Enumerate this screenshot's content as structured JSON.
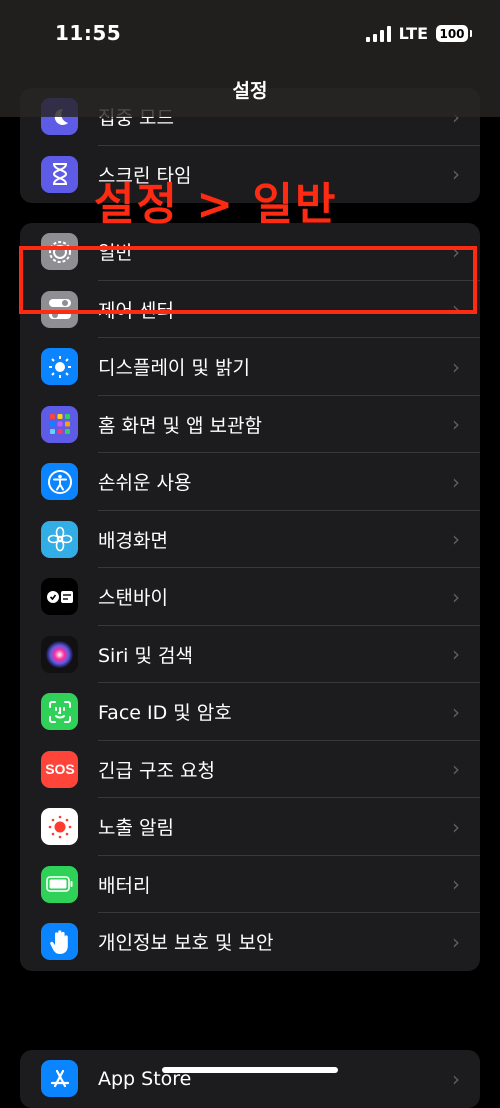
{
  "status": {
    "time": "11:55",
    "network": "LTE",
    "battery": "100"
  },
  "nav": {
    "title": "설정"
  },
  "annotation": {
    "text": "설정 > 일반"
  },
  "groups": {
    "top": [
      {
        "label": "집중 모드",
        "icon": "moon-icon",
        "color": "#5e5ce6"
      },
      {
        "label": "스크린 타임",
        "icon": "hourglass-icon",
        "color": "#5e5ce6"
      }
    ],
    "main": [
      {
        "label": "일반",
        "icon": "gear-icon",
        "color": "#8e8e93"
      },
      {
        "label": "제어 센터",
        "icon": "toggles-icon",
        "color": "#8e8e93"
      },
      {
        "label": "디스플레이 및 밝기",
        "icon": "sun-icon",
        "color": "#0a84ff"
      },
      {
        "label": "홈 화면 및 앱 보관함",
        "icon": "app-grid-icon",
        "color": "#5e5ce6"
      },
      {
        "label": "손쉬운 사용",
        "icon": "accessibility-icon",
        "color": "#0a84ff"
      },
      {
        "label": "배경화면",
        "icon": "flower-icon",
        "color": "#32ade6"
      },
      {
        "label": "스탠바이",
        "icon": "standby-icon",
        "color": "#000000"
      },
      {
        "label": "Siri 및 검색",
        "icon": "siri-icon",
        "color": "#1c1c1e"
      },
      {
        "label": "Face ID 및 암호",
        "icon": "face-id-icon",
        "color": "#30d158"
      },
      {
        "label": "긴급 구조 요청",
        "icon": "sos-icon",
        "color": "#ff453a"
      },
      {
        "label": "노출 알림",
        "icon": "exposure-icon",
        "color": "#ffffff"
      },
      {
        "label": "배터리",
        "icon": "battery-icon",
        "color": "#30d158"
      },
      {
        "label": "개인정보 보호 및 보안",
        "icon": "hand-icon",
        "color": "#0a84ff"
      }
    ],
    "bottom": [
      {
        "label": "App Store",
        "icon": "app-store-icon",
        "color": "#0a84ff"
      }
    ]
  },
  "chevron": "›"
}
